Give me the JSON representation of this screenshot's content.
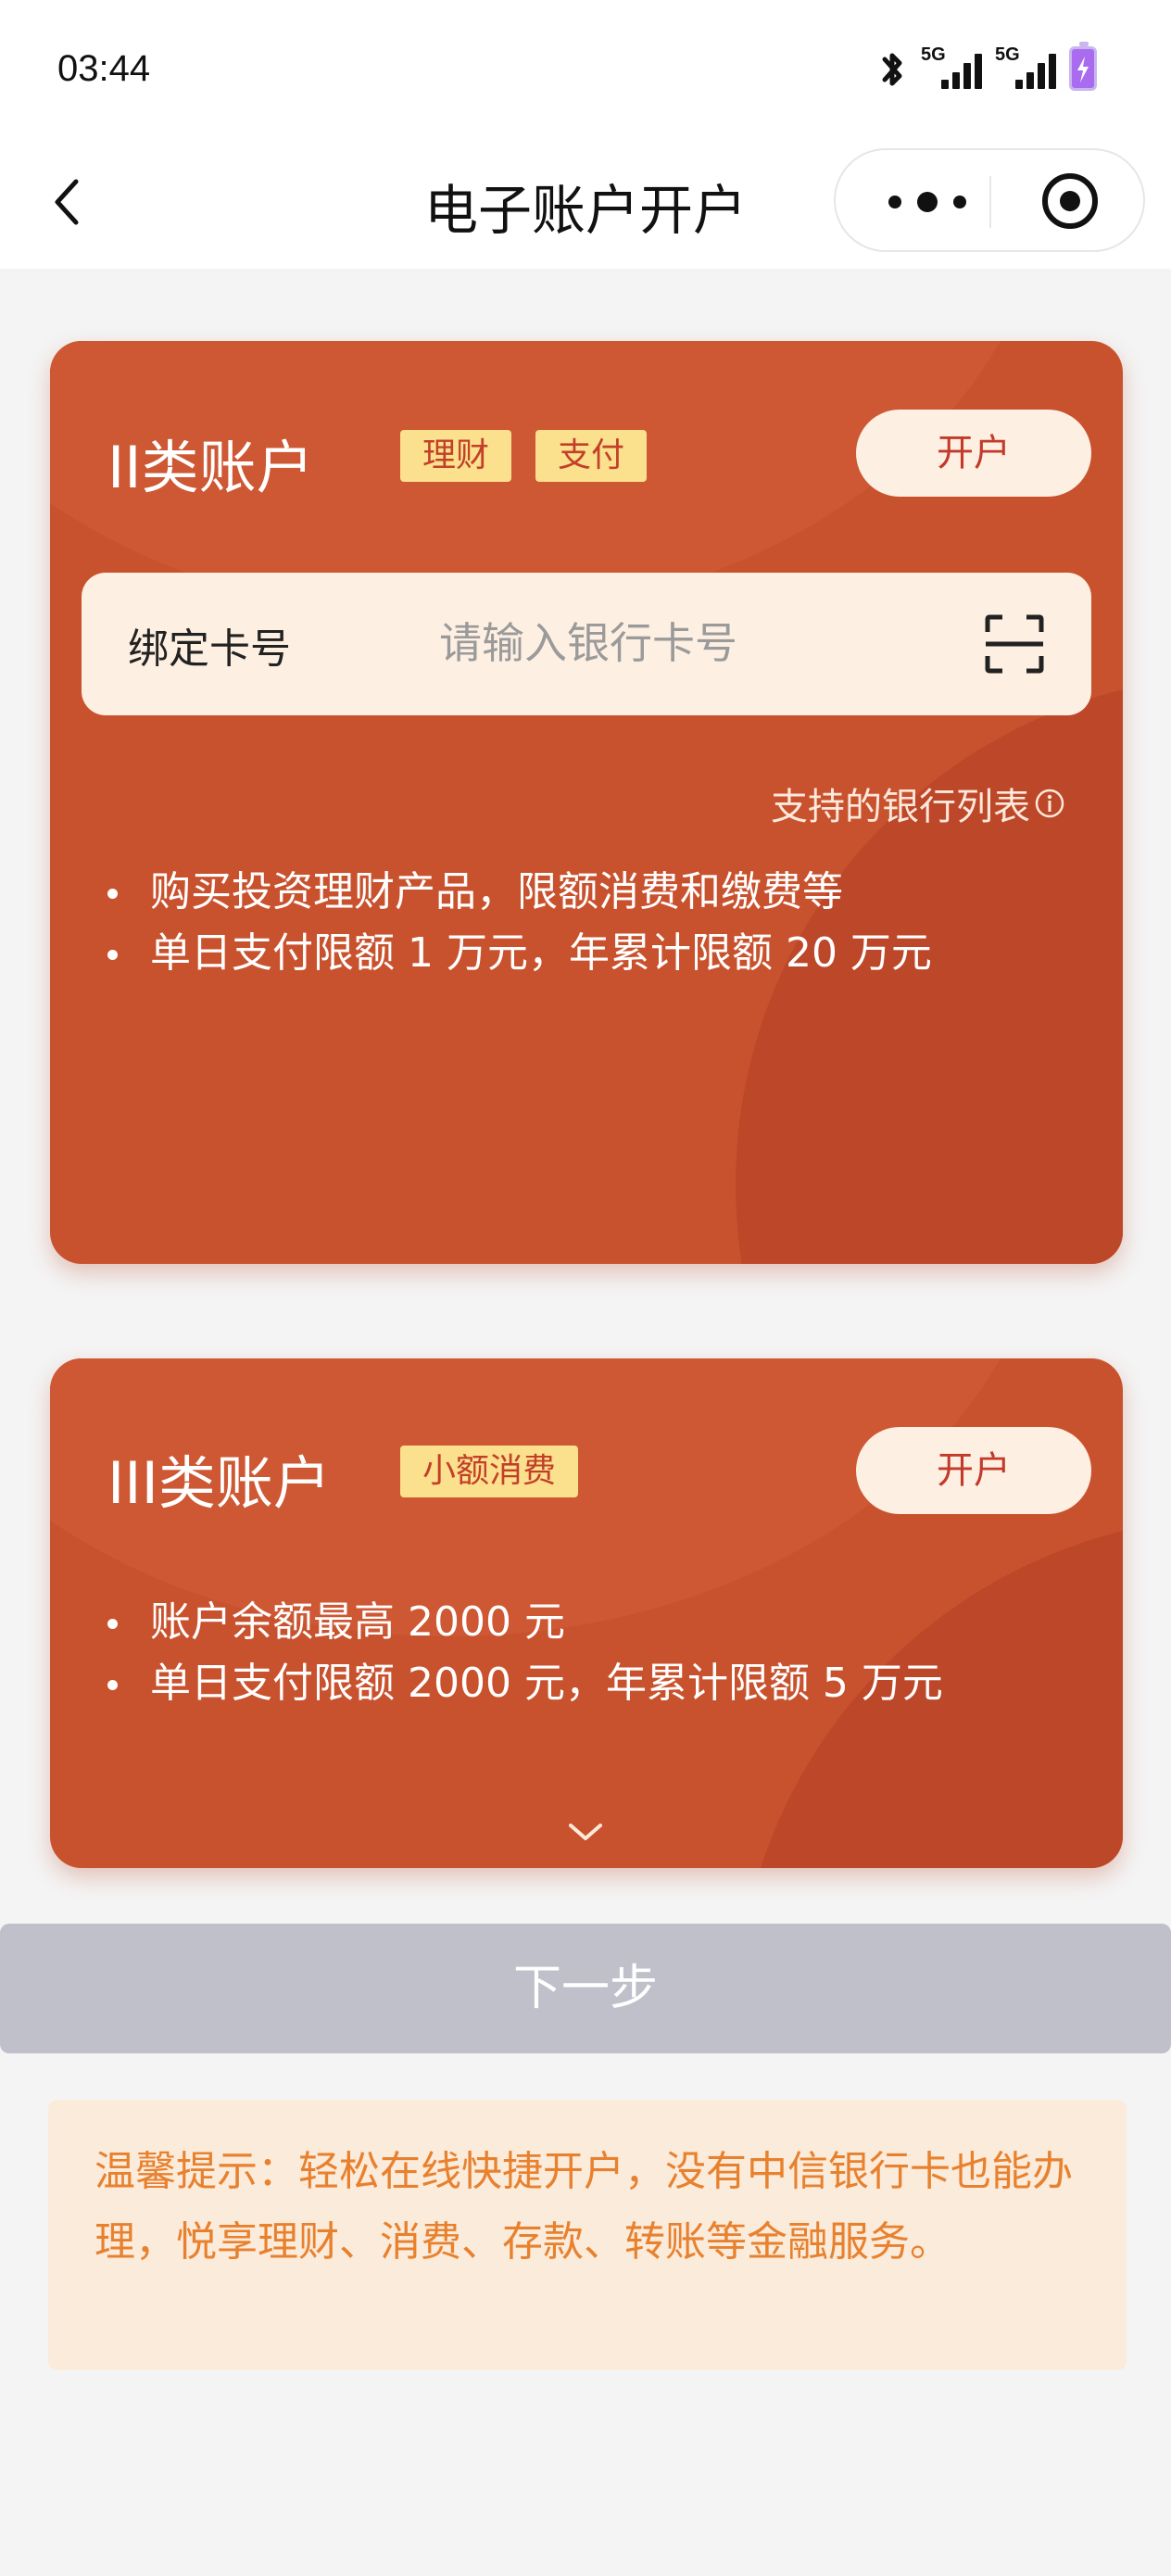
{
  "status_bar": {
    "time": "03:44",
    "network_label_1": "5G",
    "network_label_2": "5G",
    "icons": [
      "bluetooth-icon",
      "signal-icon",
      "signal-icon",
      "battery-charging-icon"
    ]
  },
  "nav": {
    "title": "电子账户开户",
    "icons": [
      "back-icon",
      "more-icon",
      "close-target-icon"
    ]
  },
  "card2": {
    "title": "II类账户",
    "tags": [
      "理财",
      "支付"
    ],
    "open_label": "开户",
    "bind_label": "绑定卡号",
    "card_input_placeholder": "请输入银行卡号",
    "card_input_value": "",
    "supported_banks": "支持的银行列表",
    "bullets": [
      "购买投资理财产品，限额消费和缴费等",
      "单日支付限额 1 万元，年累计限额 20 万元"
    ]
  },
  "card3": {
    "title": "III类账户",
    "tags": [
      "小额消费"
    ],
    "open_label": "开户",
    "bullets": [
      "账户余额最高 2000 元",
      "单日支付限额 2000 元，年累计限额 5 万元"
    ]
  },
  "next_button_label": "下一步",
  "tip_text": "温馨提示：轻松在线快捷开户，没有中信银行卡也能办理，悦享理财、消费、存款、转账等金融服务。",
  "colors": {
    "card_background": "#c9522e",
    "tag_background": "#fbe08d",
    "button_disabled": "#bfc0c9",
    "tip_text": "#e8812e",
    "tip_background": "#fbebdb"
  }
}
